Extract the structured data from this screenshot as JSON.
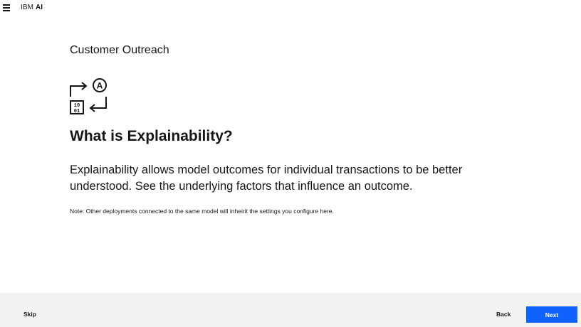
{
  "header": {
    "brand_prefix": "IBM",
    "brand_suffix": "AI",
    "menu_icon": "hamburger-menu-icon"
  },
  "main": {
    "project_title": "Customer Outreach",
    "hero_icon": "explainability-icon",
    "heading": "What is Explainability?",
    "description": "Explainability allows model outcomes for individual transactions to be better understood. See the underlying factors that influence an outcome.",
    "note": "Note: Other deployments connected to the same model will inheirit the settings you configure here."
  },
  "footer": {
    "skip_label": "Skip",
    "back_label": "Back",
    "next_label": "Next"
  },
  "colors": {
    "primary_button": "#0f62fe",
    "footer_background": "#f2f2f1",
    "text": "#161616"
  }
}
